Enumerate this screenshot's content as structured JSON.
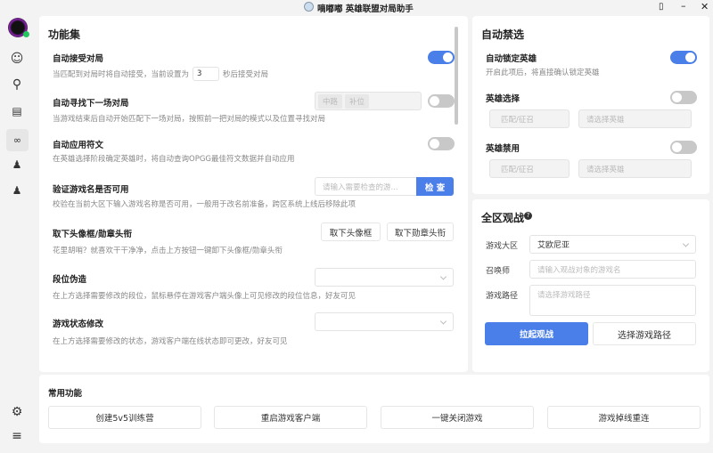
{
  "window": {
    "title": "嘀嘟嘟 英雄联盟对局助手",
    "controls": [
      "pin-icon",
      "minimize-icon",
      "close-icon"
    ]
  },
  "sidebar": {
    "items": [
      {
        "icon": "user-circle-icon"
      },
      {
        "icon": "search-icon"
      },
      {
        "icon": "chart-icon"
      },
      {
        "icon": "apps-icon",
        "active": true
      },
      {
        "icon": "user-block-icon"
      },
      {
        "icon": "user-search-icon"
      }
    ],
    "bottom": [
      {
        "icon": "gear-icon"
      },
      {
        "icon": "menu-icon"
      }
    ],
    "status_color": "#22c55e"
  },
  "features": {
    "title": "功能集",
    "rows": [
      {
        "title": "自动接受对局",
        "desc_pre": "当匹配到对局时将自动接受，当前设置为",
        "value": "3",
        "desc_post": "秒后接受对局",
        "toggle": true
      },
      {
        "title": "自动寻找下一场对局",
        "desc": "当游戏结束后自动开始匹配下一场对局，按照前一把对局的模式以及位置寻找对局",
        "tags": [
          "中路",
          "补位"
        ],
        "toggle": false
      },
      {
        "title": "自动应用符文",
        "desc": "在英雄选择阶段确定英雄时，将自动查询OPGG最佳符文数据并自动应用",
        "toggle": false
      },
      {
        "title": "验证游戏名是否可用",
        "desc": "校验在当前大区下输入游戏名称是否可用，一般用于改名前准备，跨区系统上线后移除此项",
        "placeholder": "请输入需要检查的游...",
        "button": "检 查"
      },
      {
        "title": "取下头像框/勋章头衔",
        "desc": "花里胡哨？就喜欢干干净净，点击上方按钮一键卸下头像框/勋章头衔",
        "buttons": [
          "取下头像框",
          "取下勋章头衔"
        ]
      },
      {
        "title": "段位伪造",
        "desc": "在上方选择需要修改的段位，鼠标悬停在游戏客户端头像上可见修改的段位信息，好友可见"
      },
      {
        "title": "游戏状态修改",
        "desc": "在上方选择需要修改的状态，游戏客户端在线状态即可更改，好友可见"
      }
    ]
  },
  "auto_pick": {
    "title": "自动禁选",
    "lock": {
      "title": "自动锁定英雄",
      "desc": "开启此项后，将直接确认锁定英雄",
      "toggle": true
    },
    "pick": {
      "title": "英雄选择",
      "toggle": false,
      "mode": "匹配/征召",
      "champion_placeholder": "请选择英雄"
    },
    "ban": {
      "title": "英雄禁用",
      "toggle": false,
      "mode": "匹配/征召",
      "champion_placeholder": "请选择英雄"
    }
  },
  "spectate": {
    "title": "全区观战",
    "region_label": "游戏大区",
    "region": "艾欧尼亚",
    "summoner_label": "召唤师",
    "summoner_placeholder": "请输入观战对象的游戏名",
    "path_label": "游戏路径",
    "path_placeholder": "请选择游戏路径",
    "start": "拉起观战",
    "choose_path": "选择游戏路径"
  },
  "common": {
    "title": "常用功能",
    "buttons": [
      "创建5v5训练营",
      "重启游戏客户端",
      "一键关闭游戏",
      "游戏掉线重连"
    ]
  },
  "colors": {
    "accent": "#4a7ee8",
    "bg": "#f3f3f3"
  }
}
